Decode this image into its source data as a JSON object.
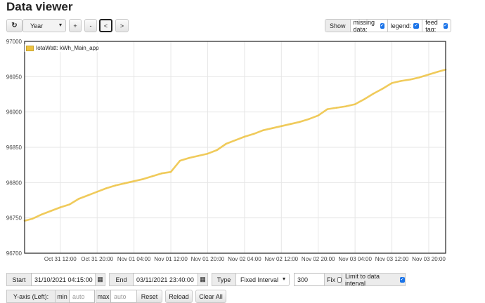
{
  "page": {
    "title": "Data viewer"
  },
  "toolbar": {
    "refresh_icon": "refresh-icon",
    "period_select": "Year",
    "zoom_in": "+",
    "zoom_out": "-",
    "pan_left": "<",
    "pan_right": ">"
  },
  "show_options": {
    "label": "Show",
    "missing_data": "missing data:",
    "legend": "legend:",
    "feed_tag": "feed tag:",
    "missing_data_checked": true,
    "legend_checked": true,
    "feed_tag_checked": true
  },
  "chart_data": {
    "type": "line",
    "title": "",
    "xlabel": "",
    "ylabel": "",
    "ylim": [
      96700,
      97000
    ],
    "yticks": [
      96700,
      96750,
      96800,
      96850,
      96900,
      96950,
      97000
    ],
    "x_range": [
      "31/10/2021 04:15",
      "03/11/2021 23:40"
    ],
    "xtick_labels": [
      "Oct 31 12:00",
      "Oct 31 20:00",
      "Nov 01 04:00",
      "Nov 01 12:00",
      "Nov 01 20:00",
      "Nov 02 04:00",
      "Nov 02 12:00",
      "Nov 02 20:00",
      "Nov 03 04:00",
      "Nov 03 12:00",
      "Nov 03 20:00"
    ],
    "grid": true,
    "legend_position": "top-left",
    "series": [
      {
        "name": "IotaWatt: kWh_Main_app",
        "color": "#edc240",
        "x": [
          "31/10/2021 04:15",
          "31/10/2021 06:00",
          "31/10/2021 08:00",
          "31/10/2021 10:00",
          "31/10/2021 12:00",
          "31/10/2021 14:00",
          "31/10/2021 16:00",
          "31/10/2021 18:00",
          "31/10/2021 20:00",
          "31/10/2021 22:00",
          "01/11/2021 00:00",
          "01/11/2021 02:00",
          "01/11/2021 04:00",
          "01/11/2021 06:00",
          "01/11/2021 08:00",
          "01/11/2021 10:00",
          "01/11/2021 12:00",
          "01/11/2021 14:00",
          "01/11/2021 16:00",
          "01/11/2021 18:00",
          "01/11/2021 20:00",
          "01/11/2021 22:00",
          "02/11/2021 00:00",
          "02/11/2021 02:00",
          "02/11/2021 04:00",
          "02/11/2021 06:00",
          "02/11/2021 08:00",
          "02/11/2021 10:00",
          "02/11/2021 12:00",
          "02/11/2021 14:00",
          "02/11/2021 16:00",
          "02/11/2021 18:00",
          "02/11/2021 20:00",
          "02/11/2021 22:00",
          "03/11/2021 00:00",
          "03/11/2021 02:00",
          "03/11/2021 04:00",
          "03/11/2021 06:00",
          "03/11/2021 08:00",
          "03/11/2021 10:00",
          "03/11/2021 12:00",
          "03/11/2021 14:00",
          "03/11/2021 16:00",
          "03/11/2021 18:00",
          "03/11/2021 20:00",
          "03/11/2021 22:00",
          "03/11/2021 23:40"
        ],
        "y": [
          96746,
          96749,
          96755,
          96760,
          96765,
          96769,
          96777,
          96782,
          96787,
          96792,
          96796,
          96799,
          96802,
          96805,
          96809,
          96813,
          96815,
          96831,
          96835,
          96838,
          96841,
          96846,
          96855,
          96860,
          96865,
          96869,
          96874,
          96877,
          96880,
          96883,
          96886,
          96890,
          96895,
          96904,
          96906,
          96908,
          96911,
          96918,
          96926,
          96933,
          96941,
          96944,
          96946,
          96949,
          96953,
          96957,
          96960
        ]
      }
    ]
  },
  "controls": {
    "start_label": "Start",
    "start_value": "31/10/2021 04:15:00",
    "end_label": "End",
    "end_value": "03/11/2021 23:40:00",
    "type_label": "Type",
    "type_select": "Fixed Interval",
    "interval_value": "300",
    "fix_label": "Fix",
    "fix_checked": false,
    "limit_label": "Limit to data interval",
    "limit_checked": true,
    "yaxis_label": "Y-axis (Left):",
    "min_label": "min",
    "min_placeholder": "auto",
    "max_label": "max",
    "max_placeholder": "auto",
    "reset_label": "Reset",
    "reload_label": "Reload",
    "clear_all_label": "Clear All"
  }
}
